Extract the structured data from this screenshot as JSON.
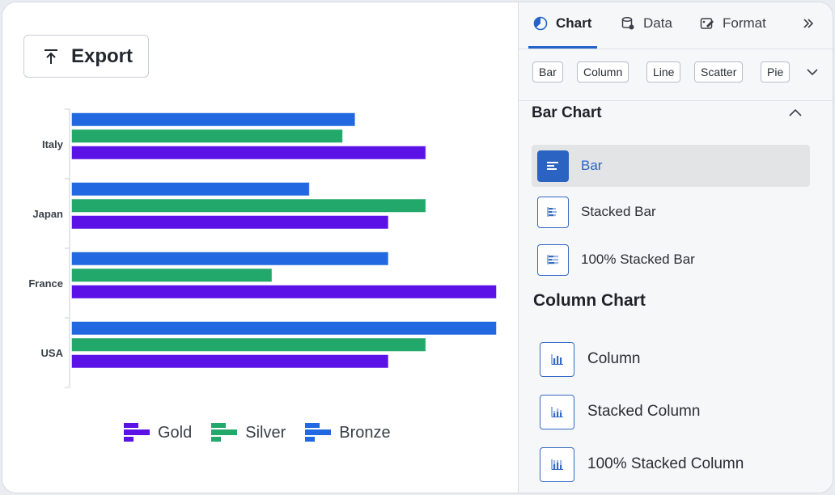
{
  "toolbar": {
    "export_label": "Export"
  },
  "chart_data": {
    "type": "bar",
    "orientation": "horizontal",
    "categories": [
      "Italy",
      "Japan",
      "France",
      "USA"
    ],
    "series": [
      {
        "name": "Gold",
        "color": "#5b12e6",
        "values": [
          85,
          76,
          102,
          76
        ]
      },
      {
        "name": "Silver",
        "color": "#22a86a",
        "values": [
          65,
          85,
          48,
          85
        ]
      },
      {
        "name": "Bronze",
        "color": "#2268e0",
        "values": [
          68,
          57,
          76,
          102
        ]
      }
    ],
    "xlim": [
      0,
      102
    ],
    "grid": false,
    "legend": "bottom"
  },
  "panel": {
    "tabs": [
      {
        "label": "Chart",
        "icon": "pie-chart-icon"
      },
      {
        "label": "Data",
        "icon": "database-icon"
      },
      {
        "label": "Format",
        "icon": "format-brush-icon"
      }
    ],
    "chart_types": [
      "Bar",
      "Column",
      "Line",
      "Scatter",
      "Pie"
    ],
    "bar_section": {
      "title": "Bar Chart",
      "options": [
        "Bar",
        "Stacked Bar",
        "100% Stacked Bar"
      ],
      "selected": "Bar"
    },
    "column_section": {
      "title": "Column Chart",
      "options": [
        "Column",
        "Stacked Column",
        "100% Stacked Column"
      ]
    },
    "accent_color": "#2563c9"
  }
}
